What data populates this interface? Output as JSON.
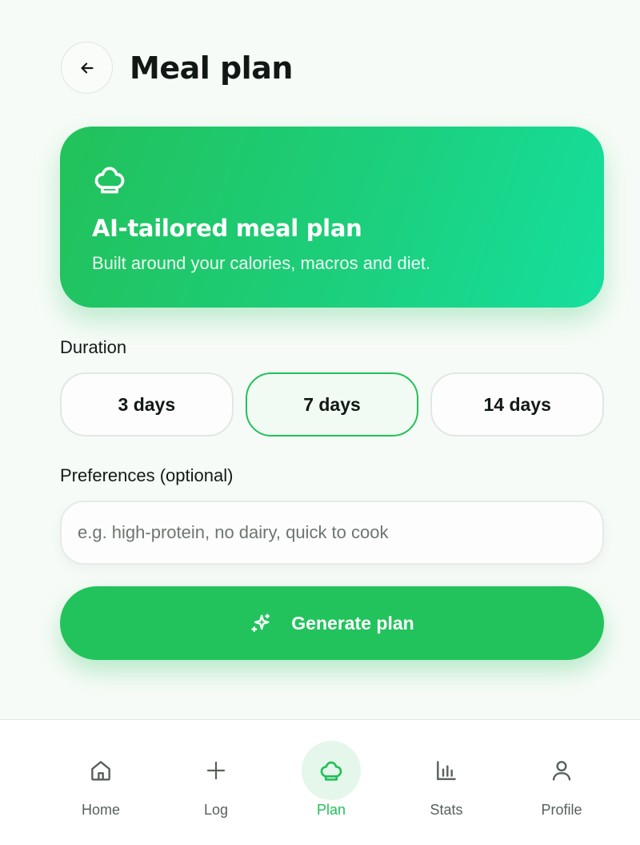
{
  "header": {
    "title": "Meal plan",
    "back_icon": "arrow-left-icon"
  },
  "hero": {
    "icon": "chef-hat-icon",
    "title": "AI-tailored meal plan",
    "subtitle": "Built around your calories, macros and diet."
  },
  "duration": {
    "label": "Duration",
    "options": [
      {
        "label": "3 days",
        "selected": false
      },
      {
        "label": "7 days",
        "selected": true
      },
      {
        "label": "14 days",
        "selected": false
      }
    ]
  },
  "preferences": {
    "label": "Preferences (optional)",
    "value": "",
    "placeholder": "e.g. high-protein, no dairy, quick to cook"
  },
  "generate": {
    "label": "Generate plan",
    "icon": "sparkles-icon"
  },
  "nav": {
    "items": [
      {
        "label": "Home",
        "icon": "home-icon",
        "active": false
      },
      {
        "label": "Log",
        "icon": "plus-icon",
        "active": false
      },
      {
        "label": "Plan",
        "icon": "chef-hat-icon",
        "active": true
      },
      {
        "label": "Stats",
        "icon": "bar-chart-icon",
        "active": false
      },
      {
        "label": "Profile",
        "icon": "user-icon",
        "active": false
      }
    ]
  },
  "colors": {
    "accent": "#22c15a",
    "accent_light": "#e5f6ea",
    "background": "#f7fbf7",
    "hero_gradient_start": "#22c15a",
    "hero_gradient_end": "#15df9e"
  }
}
